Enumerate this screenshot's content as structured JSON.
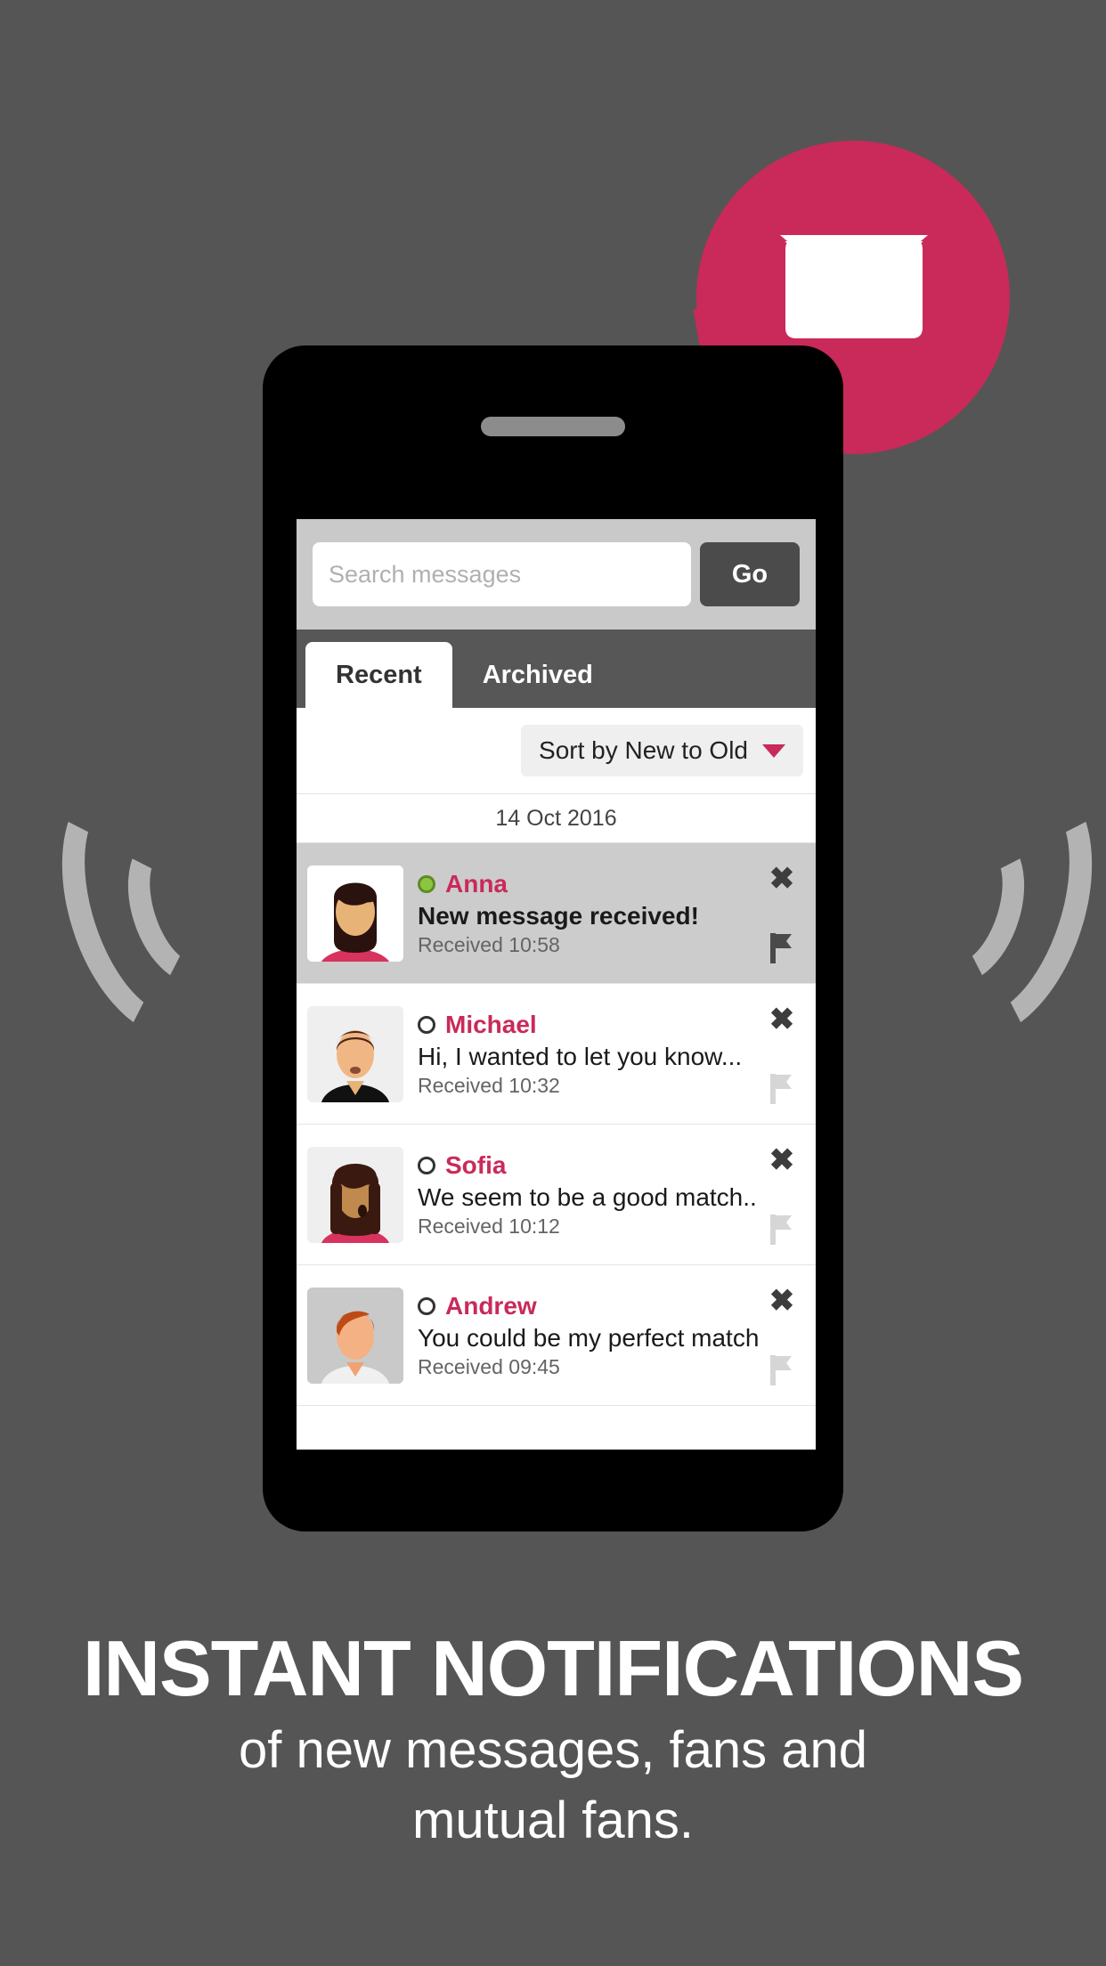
{
  "colors": {
    "background": "#555555",
    "accent": "#C92A5A",
    "phone_body": "#000000",
    "online_dot": "#8CC63F",
    "tab_bar": "#575757",
    "search_bar": "#C9C9C9"
  },
  "badge": {
    "icon": "envelope-icon"
  },
  "phone": {
    "speaker": "speaker-grille"
  },
  "search": {
    "placeholder": "Search messages",
    "value": "",
    "go_label": "Go"
  },
  "tabs": [
    {
      "label": "Recent",
      "active": true
    },
    {
      "label": "Archived",
      "active": false
    }
  ],
  "sort": {
    "label": "Sort by New to Old",
    "caret": "chevron-down-icon"
  },
  "date_divider": "14 Oct 2016",
  "messages": [
    {
      "name": "Anna",
      "preview": "New message received!",
      "time": "Received 10:58",
      "online": true,
      "unread": true,
      "flagged": true,
      "avatar": "woman-dark-hair-pink-top"
    },
    {
      "name": "Michael",
      "preview": "Hi, I wanted to let you know...",
      "time": "Received 10:32",
      "online": false,
      "unread": false,
      "flagged": false,
      "avatar": "man-dark-hair-black-top"
    },
    {
      "name": "Sofia",
      "preview": "We seem to be a good match...",
      "time": "Received 10:12",
      "online": false,
      "unread": false,
      "flagged": false,
      "avatar": "woman-braids-pink-top"
    },
    {
      "name": "Andrew",
      "preview": "You could be my perfect match...",
      "time": "Received 09:45",
      "online": false,
      "unread": false,
      "flagged": false,
      "avatar": "man-red-hair-white-top"
    }
  ],
  "row_icons": {
    "close": "✖",
    "flag": "flag-icon"
  },
  "caption": {
    "headline": "INSTANT NOTIFICATIONS",
    "subline_1": "of new messages, fans and",
    "subline_2": "mutual fans."
  }
}
